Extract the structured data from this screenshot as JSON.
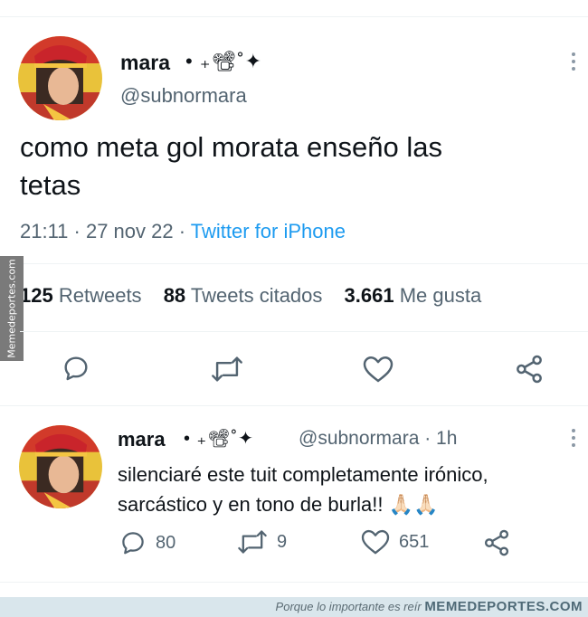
{
  "main_tweet": {
    "name": "mara",
    "name_decoration": "• ₊📽˚✦",
    "handle": "@subnormara",
    "text_line1": "como meta gol morata enseño las",
    "text_line2": "tetas",
    "timestamp": "21:11 · 27 nov 22 ·",
    "source": "Twitter for iPhone",
    "retweets_count": "125",
    "retweets_label": "Retweets",
    "quotes_count": "88",
    "quotes_label": "Tweets citados",
    "likes_count": "3.661",
    "likes_label": "Me gusta"
  },
  "reply_tweet": {
    "name": "mara",
    "name_decoration": "• ₊📽˚✦",
    "handle_time": "@subnormara · 1h",
    "text_line1": "silenciaré este tuit completamente irónico,",
    "text_line2": "sarcástico y en tono de burla!! 🙏🏻🙏🏻",
    "reply_count": "80",
    "retweet_count": "9",
    "like_count": "651"
  },
  "watermark": {
    "side_text": "Memedeportes.com",
    "footer_slogan": "Porque lo importante es reír",
    "footer_brand": "MEMEDEPORTES.COM"
  },
  "colors": {
    "text": "#0f1419",
    "secondary": "#536471",
    "link": "#1d9bf0",
    "divider": "#eff3f4"
  },
  "icons": [
    "reply-icon",
    "retweet-icon",
    "like-icon",
    "share-icon",
    "more-icon"
  ]
}
